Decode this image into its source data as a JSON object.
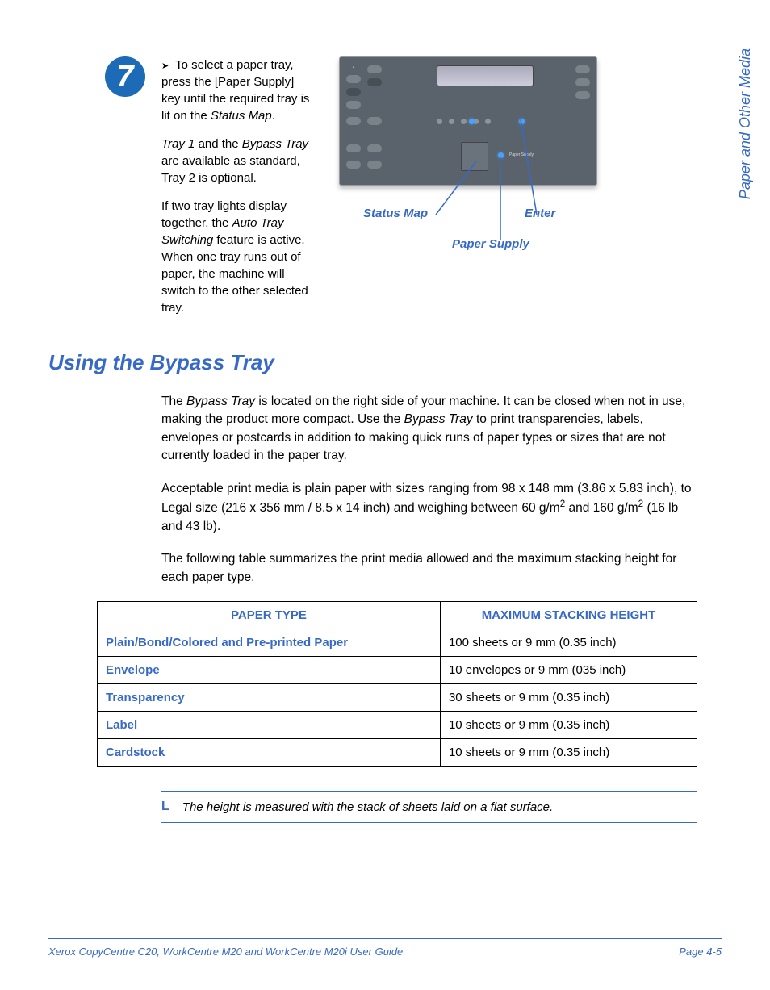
{
  "sidebar": {
    "chapter_title": "Paper and Other Media"
  },
  "step": {
    "number": "7",
    "para1_prefix": "To select a paper tray, press the [Paper Supply] key until the required tray is lit on the ",
    "para1_em": "Status Map",
    "para1_suffix": ".",
    "para2_em1": "Tray 1",
    "para2_mid": " and the ",
    "para2_em2": "Bypass Tray",
    "para2_suffix": " are available as standard, Tray 2 is optional.",
    "para3_prefix": "If two tray lights display together, the ",
    "para3_em": "Auto Tray Switching",
    "para3_suffix": " feature is active. When one tray runs out of paper, the machine will switch to the other selected tray."
  },
  "figure": {
    "callout_status_map": "Status Map",
    "callout_enter": "Enter",
    "callout_paper_supply": "Paper Supply"
  },
  "section": {
    "heading": "Using the Bypass Tray",
    "p1_prefix": "The ",
    "p1_em1": "Bypass Tray",
    "p1_mid1": " is located on the right side of your machine. It can be closed when not in use, making the product more compact. Use the ",
    "p1_em2": "Bypass Tray",
    "p1_suffix": " to print transparencies, labels, envelopes or postcards in addition to making quick runs of paper types or sizes that are not currently loaded in the paper tray.",
    "p2_prefix": "Acceptable print media is plain paper with sizes ranging from 98 x 148 mm (3.86 x 5.83 inch), to Legal size (216 x 356 mm / 8.5 x 14 inch) and weighing between 60 g/m",
    "p2_mid": " and 160 g/m",
    "p2_suffix": " (16 lb and 43 lb).",
    "p3": "The following table summarizes the print media allowed and the maximum stacking height for each paper type."
  },
  "chart_data": {
    "type": "table",
    "headers": [
      "PAPER TYPE",
      "MAXIMUM STACKING HEIGHT"
    ],
    "rows": [
      {
        "type": "Plain/Bond/Colored and Pre-printed Paper",
        "height": "100 sheets or 9 mm (0.35 inch)"
      },
      {
        "type": "Envelope",
        "height": "10 envelopes or 9 mm (035 inch)"
      },
      {
        "type": "Transparency",
        "height": "30 sheets or 9 mm (0.35 inch)"
      },
      {
        "type": "Label",
        "height": "10 sheets or 9 mm (0.35 inch)"
      },
      {
        "type": "Cardstock",
        "height": "10 sheets or 9 mm (0.35 inch)"
      }
    ]
  },
  "note": {
    "icon": "L",
    "text": "The height is measured with the stack of sheets laid on a flat surface."
  },
  "footer": {
    "left": "Xerox CopyCentre C20, WorkCentre M20 and WorkCentre M20i User Guide",
    "right": "Page 4-5"
  }
}
